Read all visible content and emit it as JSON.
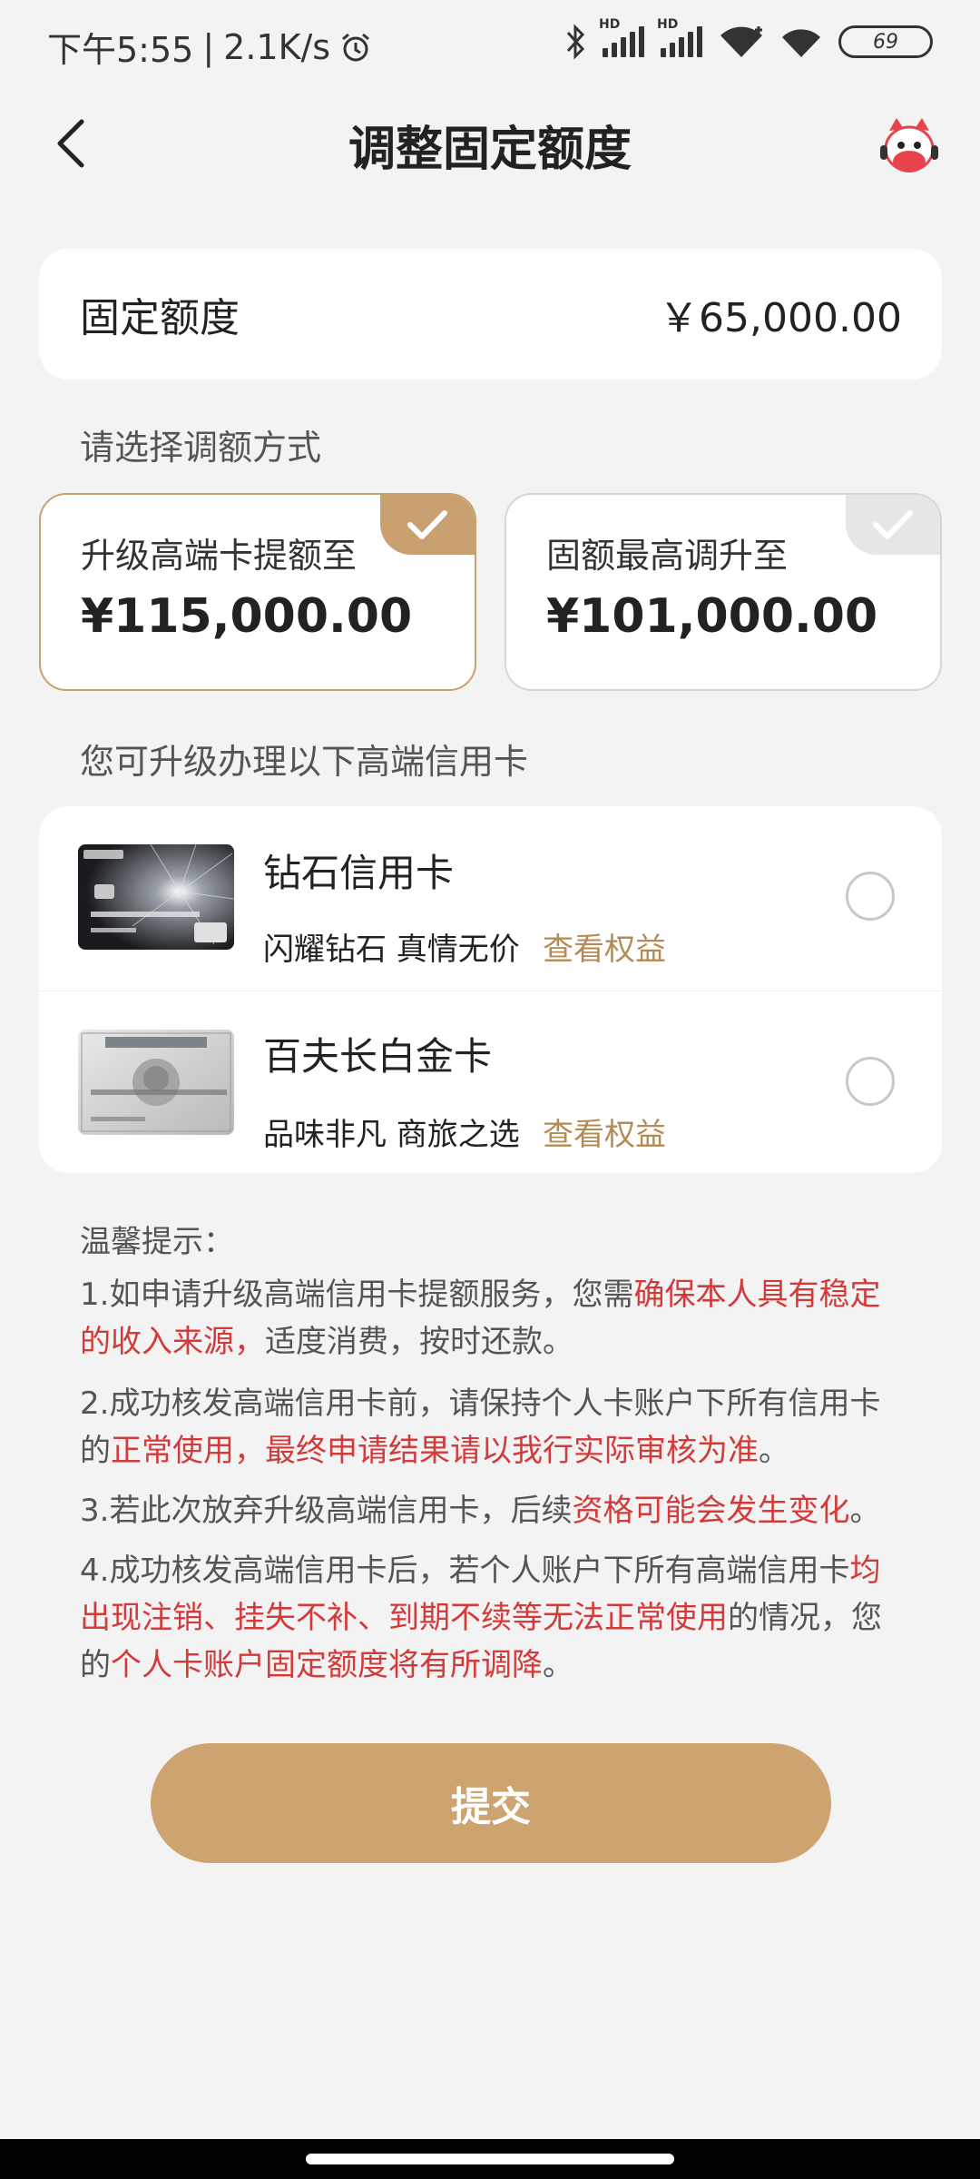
{
  "status_bar": {
    "time": "下午5:55",
    "speed": "2.1K/s",
    "signal_label": "HD",
    "battery": "69"
  },
  "header": {
    "title": "调整固定额度"
  },
  "fixed_limit": {
    "label": "固定额度",
    "value": "￥65,000.00"
  },
  "select_hint": "请选择调额方式",
  "options": [
    {
      "label": "升级高端卡提额至",
      "value": "¥115,000.00",
      "selected": true
    },
    {
      "label": "固额最高调升至",
      "value": "¥101,000.00",
      "selected": false
    }
  ],
  "upgrade_hint": "您可升级办理以下高端信用卡",
  "cards": [
    {
      "name": "钻石信用卡",
      "desc": "闪耀钻石 真情无价",
      "link": "查看权益"
    },
    {
      "name": "百夫长白金卡",
      "desc": "品味非凡 商旅之选",
      "link": "查看权益"
    }
  ],
  "tips": {
    "title": "温馨提示：",
    "t1a": "1.如申请升级高端信用卡提额服务，您需",
    "t1b": "确保本人具有稳定的收入来源，",
    "t1c": "适度消费，按时还款。",
    "t2a": "2.成功核发高端信用卡前，请保持个人卡账户下所有信用卡的",
    "t2b": "正常使用，最终申请结果请以我行实际审核为准",
    "t2c": "。",
    "t3a": "3.若此次放弃升级高端信用卡，后续",
    "t3b": "资格可能会发生变化",
    "t3c": "。",
    "t4a": "4.成功核发高端信用卡后，若个人账户下所有高端信用卡",
    "t4b": "均出现注销、挂失不补、到期不续等无法正常使用",
    "t4c": "的情况，您的",
    "t4d": "个人卡账户固定额度将有所调降",
    "t4e": "。"
  },
  "submit_label": "提交",
  "colors": {
    "accent": "#c9a170",
    "button": "#cda36f",
    "warning": "#d33a3a",
    "link": "#b58b55"
  },
  "icons": [
    "back-chevron-icon",
    "mascot-icon",
    "check-icon",
    "radio-icon",
    "alarm-icon",
    "bluetooth-icon",
    "wifi-icon",
    "battery-icon"
  ]
}
